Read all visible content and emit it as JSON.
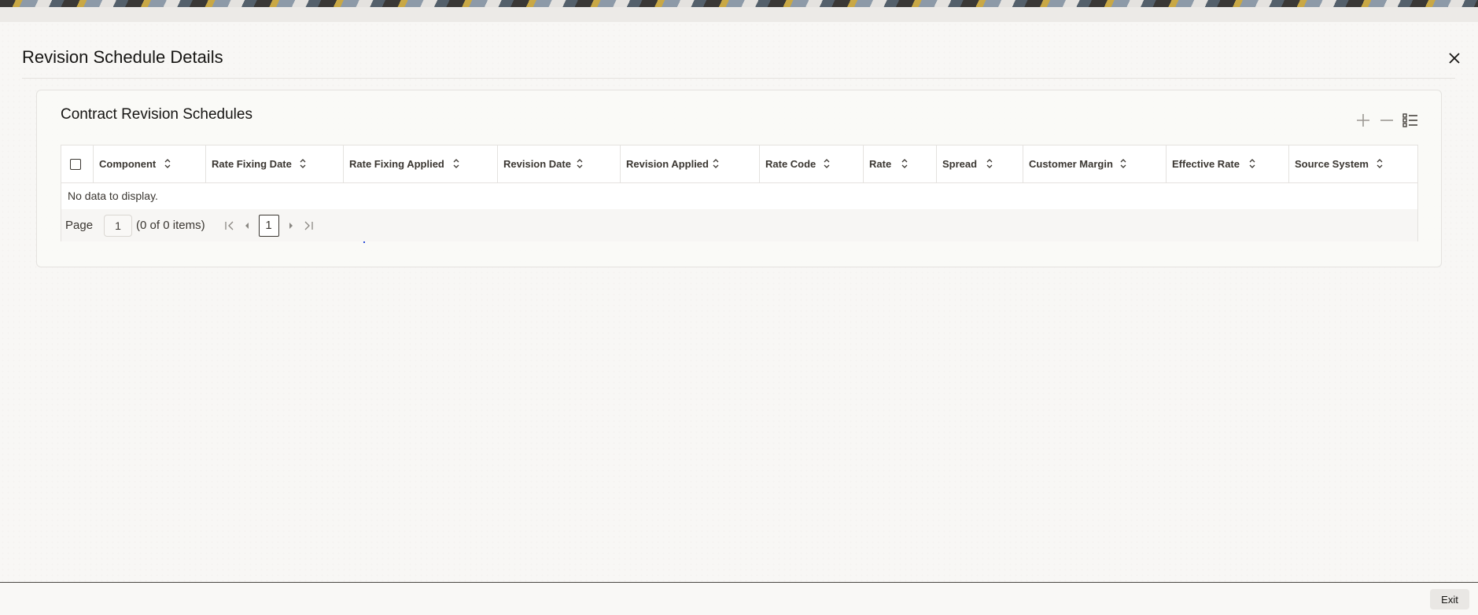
{
  "dialog": {
    "title": "Revision Schedule Details"
  },
  "panel": {
    "title": "Contract Revision Schedules"
  },
  "toolbar": {
    "icons": [
      "add-icon",
      "remove-icon",
      "column-list-icon"
    ]
  },
  "grid": {
    "columns": [
      "Component",
      "Rate Fixing Date",
      "Rate Fixing Applied",
      "Revision Date",
      "Revision Applied",
      "Rate Code",
      "Rate",
      "Spread",
      "Customer Margin",
      "Effective Rate",
      "Source System"
    ],
    "empty_message": "No data to display."
  },
  "pagination": {
    "page_label": "Page",
    "page_input": "1",
    "items_summary": "(0 of 0 items)",
    "current_page": "1"
  },
  "footer": {
    "exit_label": "Exit"
  }
}
